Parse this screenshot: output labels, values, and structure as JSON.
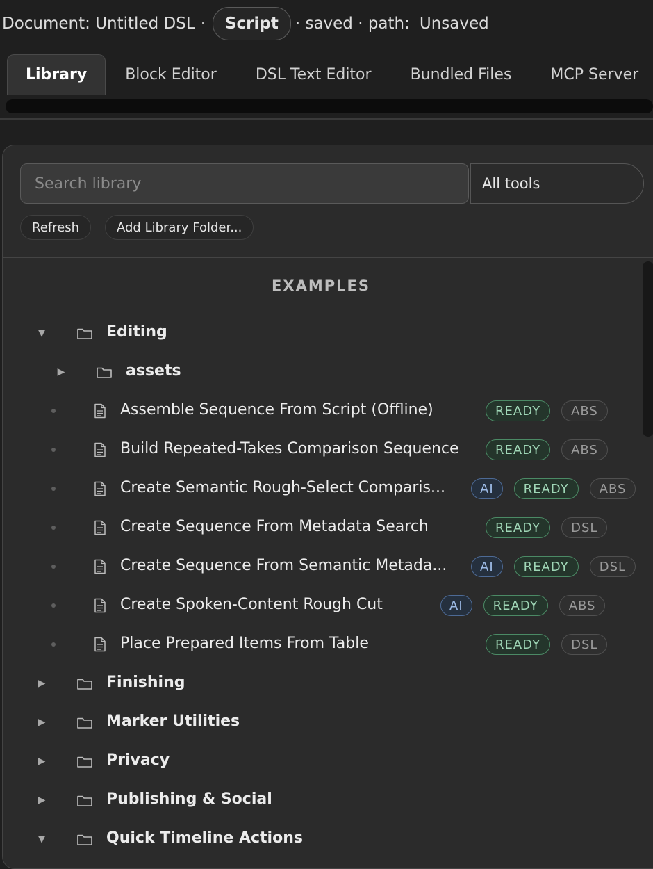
{
  "topbar": {
    "document_label": "Document: Untitled DSL",
    "separator": "·",
    "mode_pill": "Script",
    "saved_label": "· saved · path:",
    "path_value": "Unsaved"
  },
  "tabs": [
    {
      "label": "Library",
      "active": true
    },
    {
      "label": "Block Editor",
      "active": false
    },
    {
      "label": "DSL Text Editor",
      "active": false
    },
    {
      "label": "Bundled Files",
      "active": false
    },
    {
      "label": "MCP Server",
      "active": false
    }
  ],
  "toolbar": {
    "search_placeholder": "Search library",
    "filter_selected": "All tools",
    "refresh_label": "Refresh",
    "add_folder_label": "Add Library Folder..."
  },
  "library": {
    "section_title": "EXAMPLES",
    "editing_folder": "Editing",
    "assets_folder": "assets",
    "items": [
      {
        "label": "Assemble Sequence From Script (Offline)",
        "badges": [
          "READY",
          "ABS"
        ]
      },
      {
        "label": "Build Repeated-Takes Comparison Sequence",
        "badges": [
          "READY",
          "ABS"
        ]
      },
      {
        "label": "Create Semantic Rough-Select Comparis...",
        "badges": [
          "AI",
          "READY",
          "ABS"
        ]
      },
      {
        "label": "Create Sequence From Metadata Search",
        "badges": [
          "READY",
          "DSL"
        ]
      },
      {
        "label": "Create Sequence From Semantic Metada...",
        "badges": [
          "AI",
          "READY",
          "DSL"
        ]
      },
      {
        "label": "Create Spoken-Content Rough Cut",
        "badges": [
          "AI",
          "READY",
          "ABS"
        ]
      },
      {
        "label": "Place Prepared Items From Table",
        "badges": [
          "READY",
          "DSL"
        ]
      }
    ],
    "folders": [
      {
        "label": "Finishing",
        "expanded": false
      },
      {
        "label": "Marker Utilities",
        "expanded": false
      },
      {
        "label": "Privacy",
        "expanded": false
      },
      {
        "label": "Publishing & Social",
        "expanded": false
      },
      {
        "label": "Quick Timeline Actions",
        "expanded": true
      }
    ],
    "arrows": {
      "expanded": "▼",
      "collapsed": "▶"
    }
  },
  "icons": {
    "folder": "folder-icon",
    "file": "file-icon",
    "expanded": "caret-down-icon",
    "collapsed": "caret-right-icon"
  },
  "colors": {
    "ready": "#9fd6b6",
    "ai": "#9dbbe6",
    "kind": "#9a9a9a",
    "background": "#1f1f1f",
    "panel": "#2b2b2b"
  }
}
